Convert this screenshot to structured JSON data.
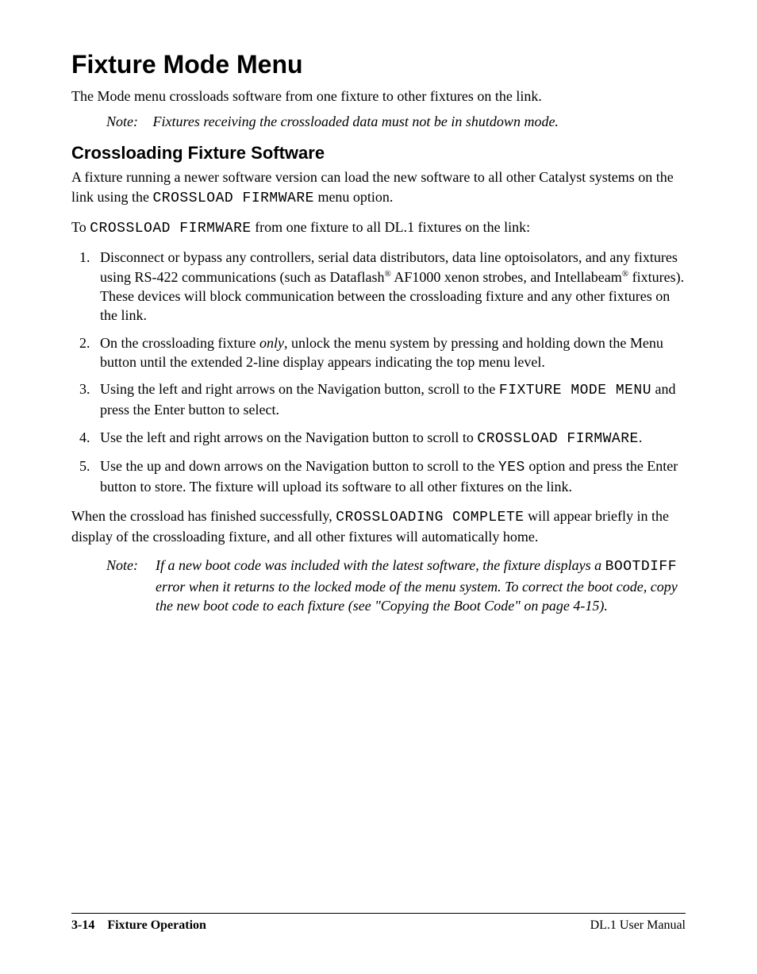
{
  "h1": "Fixture Mode Menu",
  "lead": "The Mode menu crossloads software from one fixture to other fixtures on the link.",
  "note1_label": "Note:",
  "note1_text": "Fixtures receiving the crossloaded data must not be in shutdown mode.",
  "h2": "Crossloading Fixture Software",
  "p1_a": "A fixture running a newer software version can load the new software to all other Catalyst systems on the link using the ",
  "p1_code": "CROSSLOAD FIRMWARE",
  "p1_b": " menu option.",
  "p2_a": "To ",
  "p2_code": "CROSSLOAD FIRMWARE",
  "p2_b": " from one fixture to all DL.1 fixtures on the link:",
  "li1_a": "Disconnect or bypass any controllers, serial data distributors, data line optoisolators, and any fixtures using RS-422 communications (such as Dataflash",
  "reg": "®",
  "li1_b": " AF1000 xenon strobes, and Intellabeam",
  "li1_c": " fixtures). These devices will block communication between the crossloading fixture and any other fixtures on the link.",
  "li2_a": "On the crossloading fixture ",
  "li2_em": "only",
  "li2_b": ", unlock the menu system by pressing and holding down the Menu button until the extended 2-line display appears indicating the top menu level.",
  "li3_a": "Using the left and right arrows on the Navigation button, scroll to the ",
  "li3_code": "FIXTURE MODE MENU",
  "li3_b": " and press the Enter button to select.",
  "li4_a": "Use the left and right arrows on the Navigation button to scroll to  ",
  "li4_code": "CROSSLOAD FIRMWARE",
  "li4_b": ".",
  "li5_a": "Use the up and down arrows on the Navigation button to scroll to the ",
  "li5_code": "YES",
  "li5_b": " option and press the Enter button to store. The fixture will upload its software to all other fixtures on the link.",
  "p3_a": "When the crossload has finished successfully, ",
  "p3_code": "CROSSLOADING COMPLETE",
  "p3_b": " will appear briefly in the display of the crossloading fixture, and all other fixtures will automatically home.",
  "note2_label": "Note:",
  "note2_a": "If a new boot code was included with the latest software, the fixture displays a ",
  "note2_code": "BOOTDIFF",
  "note2_b": " error when it returns to the locked mode of the menu system. To correct the boot code, copy the new boot code to each fixture (see \"Copying the Boot Code\" on page 4-15).",
  "footer_page": "3-14",
  "footer_section": "Fixture Operation",
  "footer_right": "DL.1 User Manual"
}
